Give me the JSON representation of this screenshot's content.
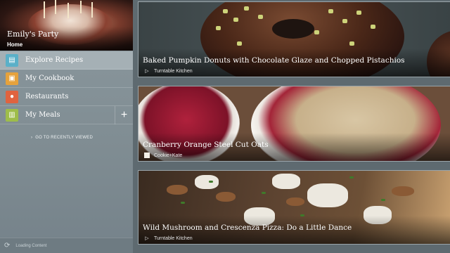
{
  "profile": {
    "title": "Emily's Party",
    "subtitle": "Home"
  },
  "nav": {
    "items": [
      {
        "label": "Explore Recipes",
        "icon": "recipe-book-icon",
        "color": "#5ab0c8",
        "active": true
      },
      {
        "label": "My Cookbook",
        "icon": "cookbook-icon",
        "color": "#e6a23c",
        "active": false
      },
      {
        "label": "Restaurants",
        "icon": "map-pin-icon",
        "color": "#e0633f",
        "active": false
      },
      {
        "label": "My Meals",
        "icon": "meals-icon",
        "color": "#9ebd4a",
        "active": false
      }
    ],
    "add_label": "+"
  },
  "recent": {
    "label": "GO TO RECENTLY VIEWED"
  },
  "status": {
    "label": "Loading Content"
  },
  "cards": [
    {
      "title": "Baked Pumpkin Donuts with Chocolate Glaze and Chopped Pistachios",
      "source": "Turntable Kitchen",
      "source_icon": "play-circle-icon"
    },
    {
      "title": "Cranberry Orange Steel Cut Oats",
      "source": "Cookie+Kate",
      "source_icon": "square-icon"
    },
    {
      "title": "Wild Mushroom and Crescenza Pizza: Do a Little Dance",
      "source": "Turntable Kitchen",
      "source_icon": "play-circle-icon"
    }
  ]
}
